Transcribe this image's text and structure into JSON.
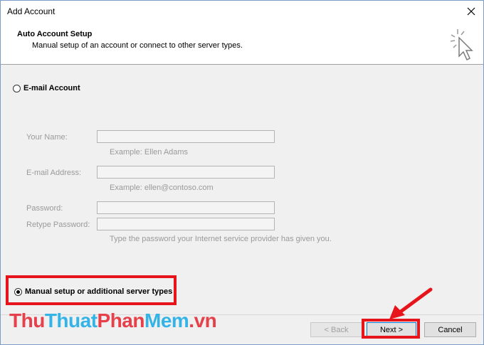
{
  "window": {
    "title": "Add Account"
  },
  "header": {
    "title": "Auto Account Setup",
    "subtitle": "Manual setup of an account or connect to other server types."
  },
  "options": {
    "email_account": "E-mail Account",
    "manual_setup": "Manual setup or additional server types"
  },
  "form": {
    "your_name_label": "Your Name:",
    "your_name_value": "",
    "your_name_hint": "Example: Ellen Adams",
    "email_label": "E-mail Address:",
    "email_value": "",
    "email_hint": "Example: ellen@contoso.com",
    "password_label": "Password:",
    "password_value": "",
    "retype_label": "Retype Password:",
    "retype_value": "",
    "password_hint": "Type the password your Internet service provider has given you."
  },
  "buttons": {
    "back": "< Back",
    "next": "Next >",
    "cancel": "Cancel"
  },
  "watermark": {
    "part1": "Thu",
    "part2": "Thuat",
    "part3": "Phan",
    "part4": "Mem",
    "part5": ".vn"
  },
  "colors": {
    "highlight": "#e8141c",
    "accent": "#0078d7"
  }
}
